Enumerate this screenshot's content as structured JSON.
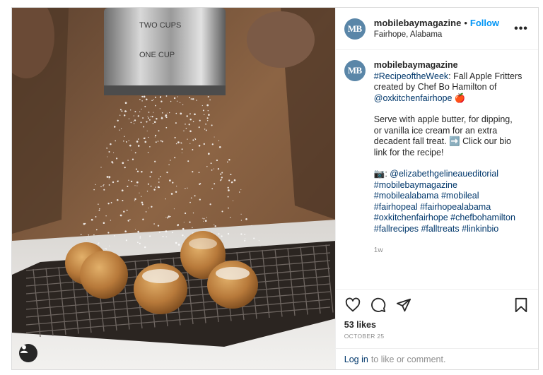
{
  "photo": {
    "alt": "Powdered sugar sifted over apple fritters on a cooling rack",
    "sifter_text_top": "TWO   CUPS",
    "sifter_text_mid": "ONE   CUP"
  },
  "header": {
    "avatar_text": "MB",
    "username": "mobilebaymagazine",
    "separator": "•",
    "follow_label": "Follow",
    "location": "Fairhope, Alabama",
    "more_label": "•••"
  },
  "caption": {
    "avatar_text": "MB",
    "username": "mobilebaymagazine",
    "hashtag_rotw": "#RecipeoftheWeek",
    "intro_text": ": Fall Apple Fritters created by Chef Bo Hamilton of ",
    "mention_ox": "@oxkitchenfairhope",
    "apple_emoji": "🍎",
    "body_text": "Serve with apple butter, for dipping, or vanilla ice cream for an extra decadent fall treat. ➡️ Click our bio link for the recipe!",
    "camera_emoji": "📷",
    "credit_sep": ": ",
    "mention_photo": "@elizabethgelineaueditorial",
    "hashtags": "#mobilebaymagazine #mobilealabama #mobileal #fairhopeal #fairhopealabama #oxkitchenfairhope #chefbohamilton #fallrecipes #falltreats #linkinbio",
    "time": "1w"
  },
  "actions": {
    "like_icon": "heart-icon",
    "comment_icon": "comment-icon",
    "share_icon": "send-icon",
    "save_icon": "bookmark-icon"
  },
  "likes": "53 likes",
  "date": "OCTOBER 25",
  "login": {
    "link_label": "Log in",
    "rest_text": "to like or comment."
  },
  "colors": {
    "link_blue": "#0095f6",
    "tag_blue": "#00376b",
    "avatar_blue": "#5a86a8",
    "muted": "#8e8e8e"
  }
}
